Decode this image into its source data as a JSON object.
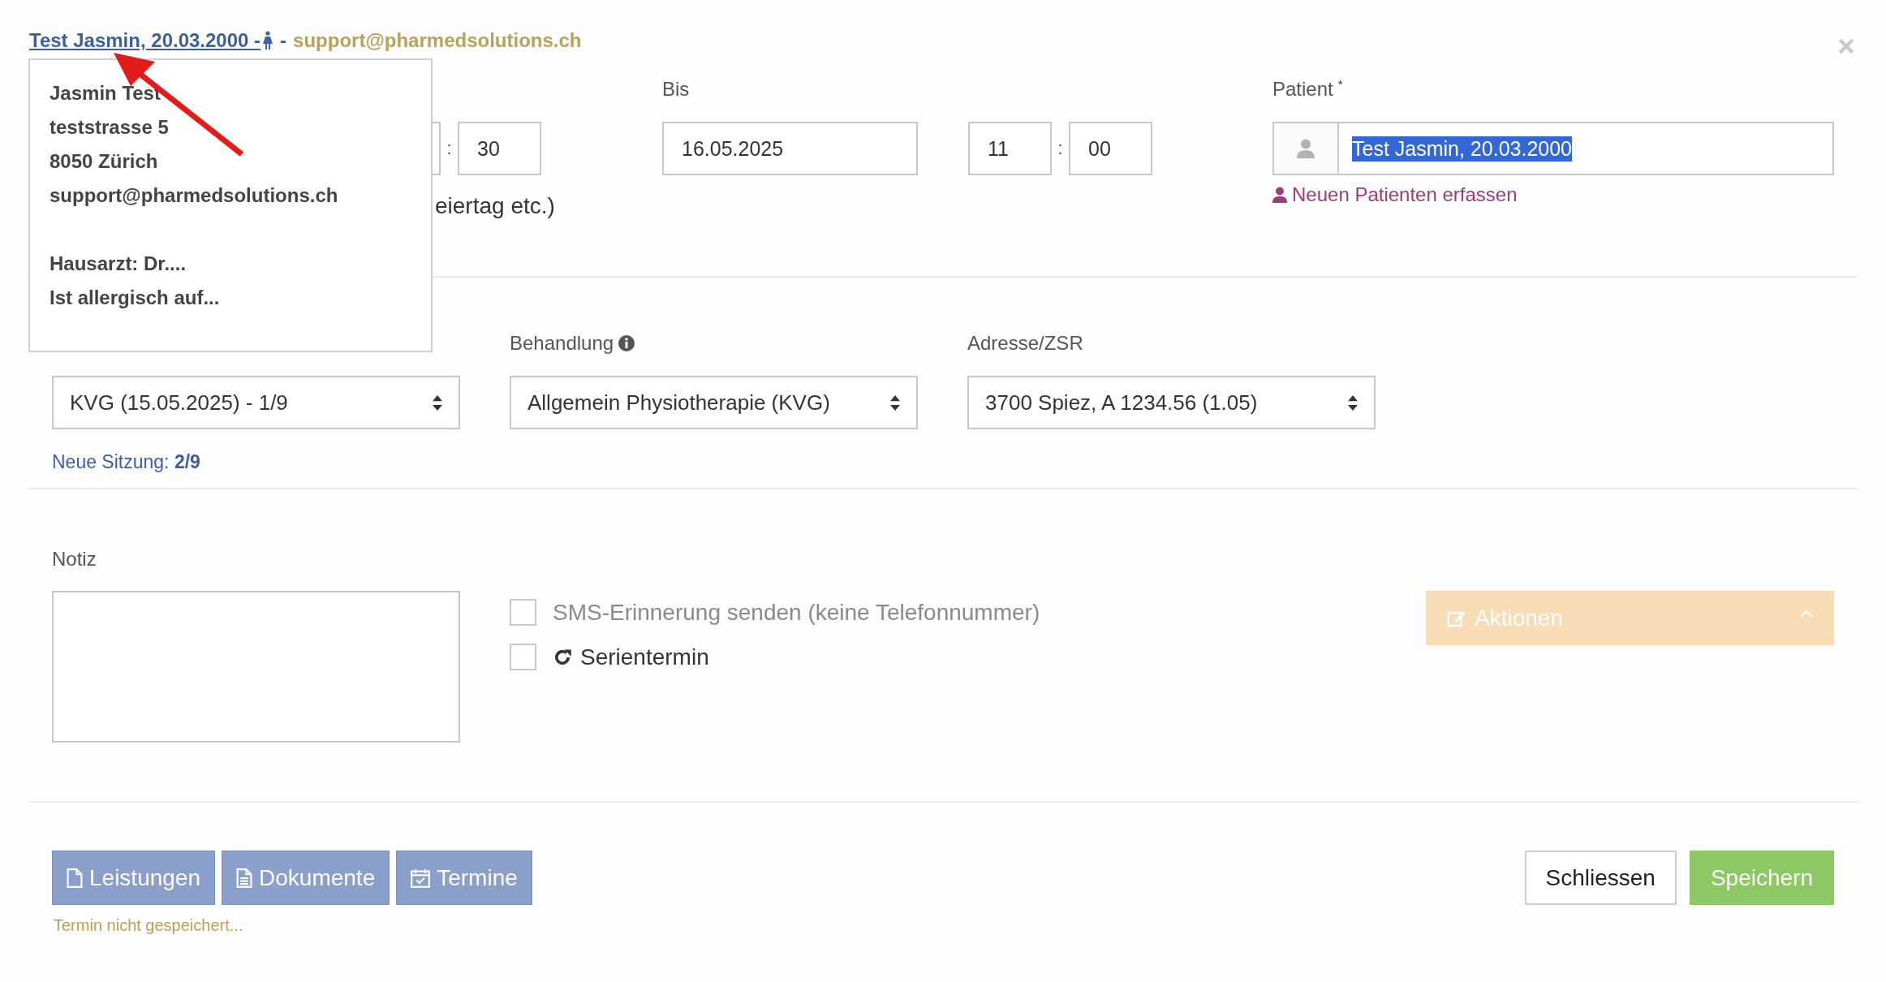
{
  "header": {
    "patient_link": "Test Jasmin, 20.03.2000 -",
    "separator": "-",
    "email": "support@pharmedsolutions.ch"
  },
  "tooltip": {
    "address_lines": [
      "Jasmin Test",
      "teststrasse 5",
      "8050 Zürich",
      "support@pharmedsolutions.ch"
    ],
    "note_lines": [
      "Hausarzt: Dr....",
      "Ist allergisch auf..."
    ]
  },
  "von": {
    "time_separator": ":",
    "minute": "30",
    "hint": "eiertag etc.)"
  },
  "bis": {
    "label": "Bis",
    "date": "16.05.2025",
    "hour": "11",
    "time_separator": ":",
    "minute": "00"
  },
  "patient": {
    "label": "Patient",
    "required_mark": "*",
    "value": "Test Jasmin, 20.03.2000",
    "value_selected": true,
    "new_patient_link": "Neuen Patienten erfassen"
  },
  "invoice": {
    "value": "KVG (15.05.2025) - 1/9",
    "new_session": "Neue Sitzung: **2/9**"
  },
  "treatment": {
    "label": "Behandlung",
    "value": "Allgemein Physiotherapie (KVG)"
  },
  "address": {
    "label": "Adresse/ZSR",
    "value": "3700 Spiez, A 1234.56 (1.05)"
  },
  "note": {
    "label": "Notiz"
  },
  "options": [
    {
      "label": "SMS-Erinnerung senden (keine Telefonnummer)",
      "checked": false,
      "disabled": true,
      "kind": "plain"
    },
    {
      "label": "Serientermin",
      "checked": false,
      "disabled": false,
      "kind": "repeat"
    }
  ],
  "actions": {
    "label": "Aktionen",
    "disabled": true
  },
  "footer_buttons": [
    {
      "label": "Leistungen",
      "kind": "file"
    },
    {
      "label": "Dokumente",
      "kind": "document"
    },
    {
      "label": "Termine",
      "kind": "calendar"
    }
  ],
  "close_button": {
    "label": "Schliessen"
  },
  "save_button": {
    "label": "Speichern"
  },
  "status": "Termin nicht gespeichert..."
}
